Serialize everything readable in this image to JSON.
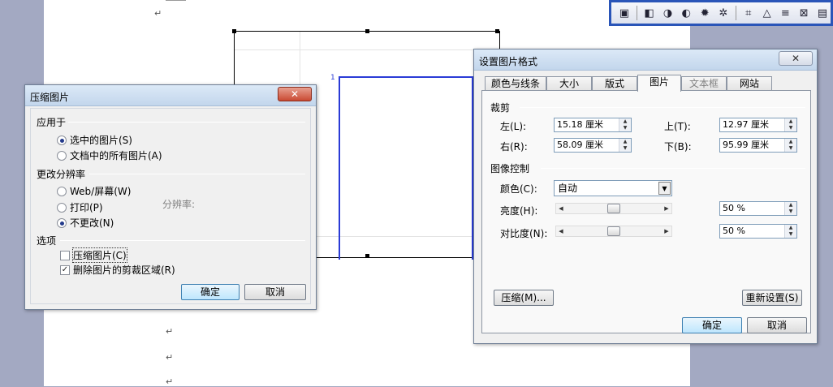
{
  "document": {
    "para_mark": "↵",
    "corner_number": "1"
  },
  "toolbar": {
    "icons": [
      "picture-icon",
      "color-icon",
      "contrast-more-icon",
      "contrast-less-icon",
      "brightness-more-icon",
      "brightness-less-icon",
      "crop-icon",
      "rotate-icon",
      "line-style-icon",
      "compress-icon",
      "format-picture-icon"
    ]
  },
  "compress_dialog": {
    "title": "压缩图片",
    "close_label": "✕",
    "apply_to_label": "应用于",
    "apply_options": [
      "选中的图片(S)",
      "文档中的所有图片(A)"
    ],
    "resolution_label": "更改分辨率",
    "resolution_options": [
      "Web/屏幕(W)",
      "打印(P)",
      "不更改(N)"
    ],
    "resolution_value_label": "分辨率:",
    "options_label": "选项",
    "checkboxes": [
      "压缩图片(C)",
      "删除图片的剪裁区域(R)"
    ],
    "ok_label": "确定",
    "cancel_label": "取消"
  },
  "format_dialog": {
    "title": "设置图片格式",
    "close_label": "✕",
    "tabs": [
      "颜色与线条",
      "大小",
      "版式",
      "图片",
      "文本框",
      "网站"
    ],
    "crop_label": "裁剪",
    "crop_fields": {
      "left_label": "左(L):",
      "left_value": "15.18 厘米",
      "right_label": "右(R):",
      "right_value": "58.09 厘米",
      "top_label": "上(T):",
      "top_value": "12.97 厘米",
      "bottom_label": "下(B):",
      "bottom_value": "95.99 厘米"
    },
    "image_control_label": "图像控制",
    "color_label": "颜色(C):",
    "color_value": "自动",
    "brightness_label": "亮度(H):",
    "brightness_value": "50 %",
    "contrast_label": "对比度(N):",
    "contrast_value": "50 %",
    "brightness_level_pct": 50,
    "contrast_level_pct": 50,
    "compress_button": "压缩(M)...",
    "reset_button": "重新设置(S)",
    "ok_label": "确定",
    "cancel_label": "取消"
  },
  "colors": {
    "accent": "#2a3bd6",
    "toolbar_frame": "#2a55b8",
    "workspace": "#a3a9c2"
  }
}
